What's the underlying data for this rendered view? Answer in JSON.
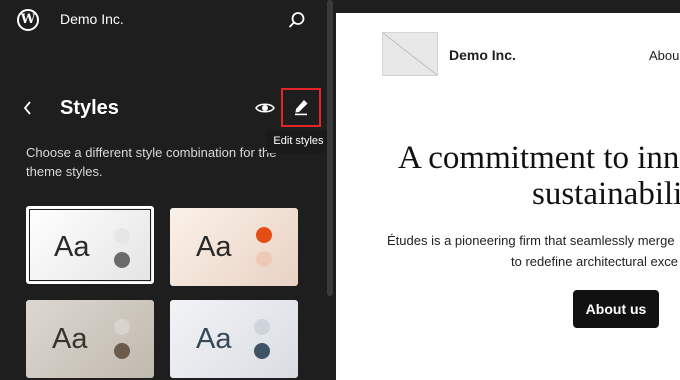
{
  "topbar": {
    "site_name": "Demo Inc.",
    "logo_icon": "wordpress-logo-icon",
    "search_icon": "search-icon"
  },
  "panel": {
    "title": "Styles",
    "back_icon": "chevron-left-icon",
    "preview_icon": "eye-icon",
    "edit_icon": "pencil-icon",
    "edit_tooltip": "Edit styles",
    "description": "Choose a different style combination for the theme styles."
  },
  "style_variations": [
    {
      "sample": "Aa",
      "selected": true,
      "text_color": "#2a2a2a",
      "dot_colors": [
        "#e6e6e6",
        "#6b6b6b"
      ]
    },
    {
      "sample": "Aa",
      "selected": false,
      "text_color": "#2a2a2a",
      "dot_colors": [
        "#e44e14",
        "#eec9b6"
      ]
    },
    {
      "sample": "Aa",
      "selected": false,
      "text_color": "#3a332b",
      "dot_colors": [
        "#d8d3cc",
        "#6b5b4c"
      ]
    },
    {
      "sample": "Aa",
      "selected": false,
      "text_color": "#34495a",
      "dot_colors": [
        "#cfd4da",
        "#3e5363"
      ]
    }
  ],
  "preview": {
    "site_name": "Demo Inc.",
    "nav_item": "Abou",
    "headline_line1": "A commitment to inn",
    "headline_line2": "sustainabilit",
    "body_line1": "Études is a pioneering firm that seamlessly merge",
    "body_line2": "to redefine architectural exce",
    "cta_label": "About us"
  },
  "colors": {
    "sidebar_bg": "#1e1e1e",
    "highlight": "#e32525",
    "preview_bg": "#ffffff"
  }
}
